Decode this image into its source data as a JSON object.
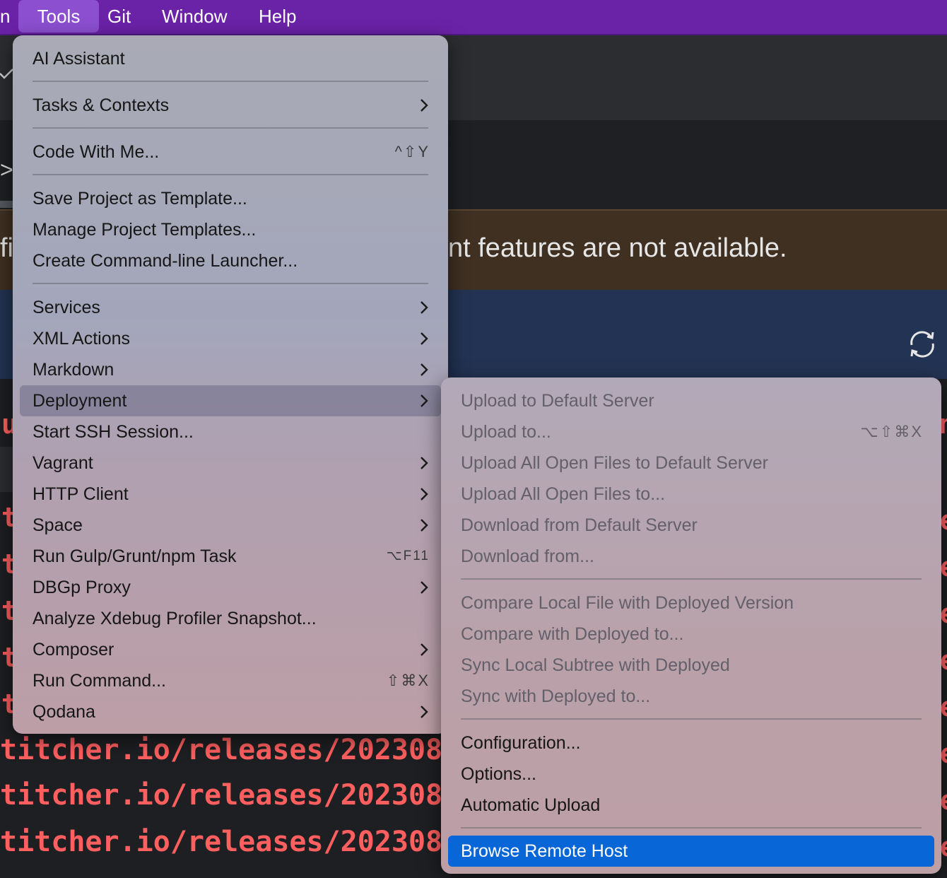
{
  "menubar": {
    "partial_left": "n",
    "items": [
      {
        "label": "Tools",
        "active": true
      },
      {
        "label": "Git"
      },
      {
        "label": "Window"
      },
      {
        "label": "Help"
      }
    ]
  },
  "background": {
    "banner_text": "nt features are not available.",
    "banner_left": "fi",
    "console_lines": [
      "titcher.io/releases/202308",
      "titcher.io/releases/202308",
      "titcher.io/releases/202308"
    ],
    "edge_char_left": "t",
    "edge_char_right": "e",
    "edge_u": "u",
    "edge_n": "n"
  },
  "tools_menu": {
    "items": [
      {
        "label": "AI Assistant"
      },
      {
        "label": "Tasks & Contexts",
        "submenu": true
      },
      {
        "label": "Code With Me...",
        "shortcut": "^⇧Y"
      },
      {
        "label": "Save Project as Template..."
      },
      {
        "label": "Manage Project Templates..."
      },
      {
        "label": "Create Command-line Launcher..."
      },
      {
        "label": "Services",
        "submenu": true
      },
      {
        "label": "XML Actions",
        "submenu": true
      },
      {
        "label": "Markdown",
        "submenu": true
      },
      {
        "label": "Deployment",
        "submenu": true,
        "selected": true
      },
      {
        "label": "Start SSH Session..."
      },
      {
        "label": "Vagrant",
        "submenu": true
      },
      {
        "label": "HTTP Client",
        "submenu": true
      },
      {
        "label": "Space",
        "submenu": true
      },
      {
        "label": "Run Gulp/Grunt/npm Task",
        "shortcut": "⌥F11"
      },
      {
        "label": "DBGp Proxy",
        "submenu": true
      },
      {
        "label": "Analyze Xdebug Profiler Snapshot..."
      },
      {
        "label": "Composer",
        "submenu": true
      },
      {
        "label": "Run Command...",
        "shortcut": "⇧⌘X"
      },
      {
        "label": "Qodana",
        "submenu": true
      }
    ]
  },
  "deployment_menu": {
    "items": [
      {
        "label": "Upload to Default Server",
        "disabled": true
      },
      {
        "label": "Upload to...",
        "disabled": true,
        "shortcut": "⌥⇧⌘X"
      },
      {
        "label": "Upload All Open Files to Default Server",
        "disabled": true
      },
      {
        "label": "Upload All Open Files to...",
        "disabled": true
      },
      {
        "label": "Download from Default Server",
        "disabled": true
      },
      {
        "label": "Download from...",
        "disabled": true
      },
      {
        "label": "Compare Local File with Deployed Version",
        "disabled": true
      },
      {
        "label": "Compare with Deployed to...",
        "disabled": true
      },
      {
        "label": "Sync Local Subtree with Deployed",
        "disabled": true
      },
      {
        "label": "Sync with Deployed to...",
        "disabled": true
      },
      {
        "label": "Configuration..."
      },
      {
        "label": "Options..."
      },
      {
        "label": "Automatic Upload"
      },
      {
        "label": "Browse Remote Host",
        "selected": true
      }
    ]
  }
}
